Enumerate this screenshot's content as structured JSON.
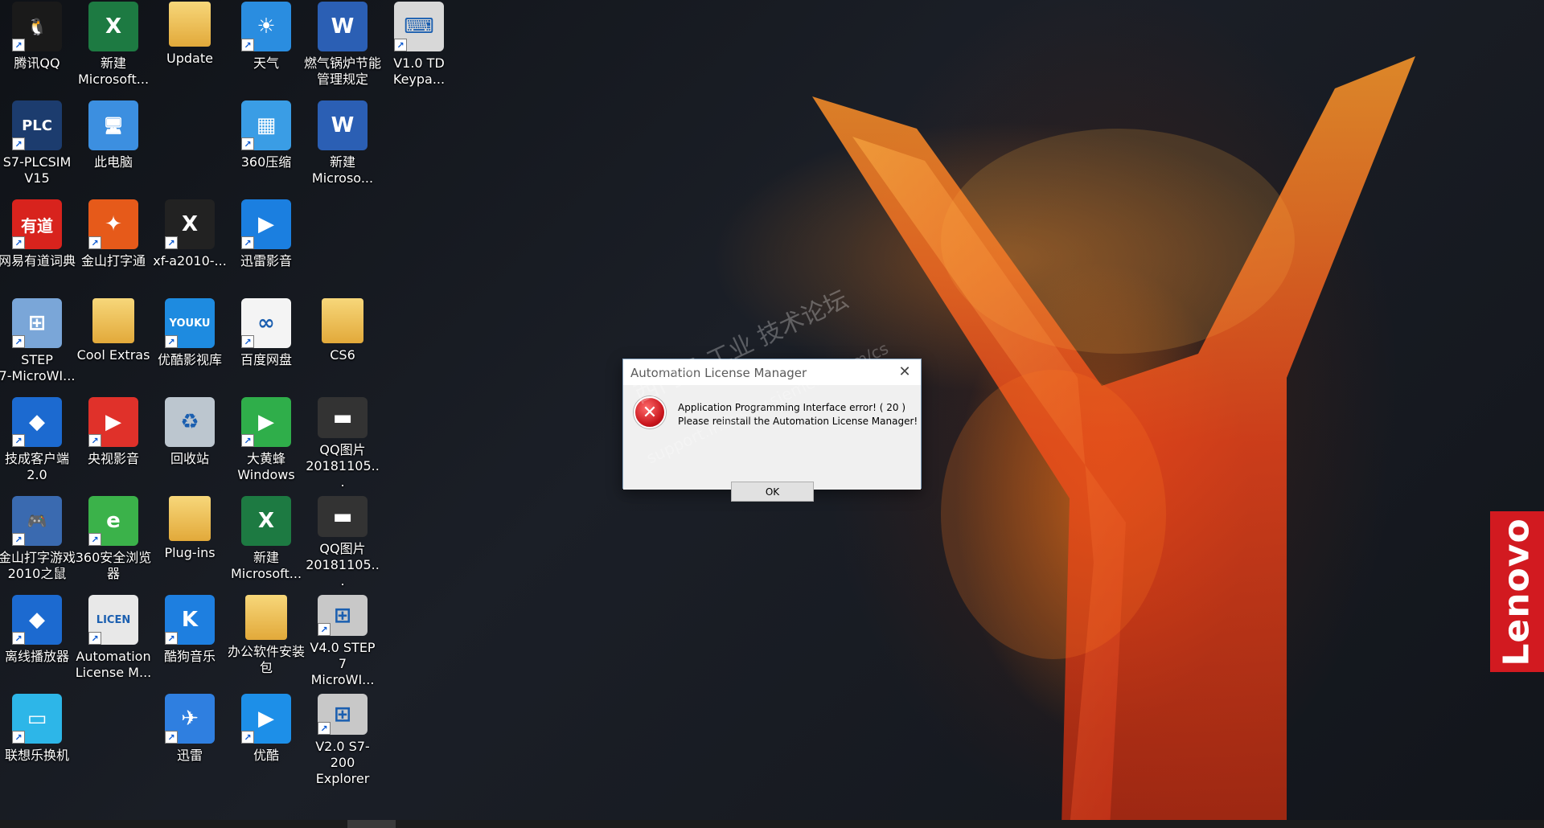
{
  "desktop": {
    "icons": [
      {
        "label": "腾讯QQ",
        "icon": "qq-penguin-icon",
        "color": "#1a1a1a",
        "glyph": "🐧"
      },
      {
        "label": "新建\nMicrosoft...",
        "icon": "excel-file-icon",
        "color": "#1d7a42",
        "glyph": "X"
      },
      {
        "label": "Update",
        "icon": "folder-icon",
        "color": "#e9b949",
        "glyph": ""
      },
      {
        "label": "天气",
        "icon": "weather-sun-icon",
        "color": "#2a8de0",
        "glyph": "☀"
      },
      {
        "label": "燃气锅炉节能\n管理规定",
        "icon": "word-document-icon",
        "color": "#2b5fb4",
        "glyph": "W"
      },
      {
        "label": "V1.0 TD\nKeypa...",
        "icon": "td-keypad-icon",
        "color": "#d8d8d8",
        "glyph": "⌨"
      },
      {
        "label": "S7-PLCSIM\nV15",
        "icon": "plcsim-icon",
        "color": "#1c3c6e",
        "glyph": "PLC"
      },
      {
        "label": "此电脑",
        "icon": "computer-icon",
        "color": "#3c8fe0",
        "glyph": "🖥"
      },
      {
        "label": "360压缩",
        "icon": "archive-360-icon",
        "color": "#3a9de5",
        "glyph": "▦"
      },
      {
        "label": "新建\nMicroso...",
        "icon": "word-document-icon",
        "color": "#2b5fb4",
        "glyph": "W"
      },
      {
        "label": "网易有道词典",
        "icon": "youdao-dictionary-icon",
        "color": "#d8231d",
        "glyph": "有道"
      },
      {
        "label": "金山打字通",
        "icon": "kingsoft-typing-icon",
        "color": "#e65a1a",
        "glyph": "✦"
      },
      {
        "label": "xf-a2010-...",
        "icon": "keygen-x-icon",
        "color": "#222222",
        "glyph": "X"
      },
      {
        "label": "迅雷影音",
        "icon": "xunlei-player-icon",
        "color": "#1b7fe0",
        "glyph": "▶"
      },
      {
        "label": "STEP\n7-MicroWI...",
        "icon": "step7-microwin-icon",
        "color": "#7aa6d8",
        "glyph": "⊞"
      },
      {
        "label": "Cool Extras",
        "icon": "folder-icon",
        "color": "#e9b949",
        "glyph": ""
      },
      {
        "label": "优酷影视库",
        "icon": "youku-cloud-icon",
        "color": "#1e8be0",
        "glyph": "YOUKU"
      },
      {
        "label": "百度网盘",
        "icon": "baidu-netdisk-icon",
        "color": "#f4f4f4",
        "glyph": "∞"
      },
      {
        "label": "CS6",
        "icon": "folder-icon",
        "color": "#e9b949",
        "glyph": ""
      },
      {
        "label": "技成客户端\n2.0",
        "icon": "jicheng-client-icon",
        "color": "#1c6ad0",
        "glyph": "◆"
      },
      {
        "label": "央视影音",
        "icon": "cctv-player-icon",
        "color": "#e0312a",
        "glyph": "▶"
      },
      {
        "label": "回收站",
        "icon": "recycle-bin-icon",
        "color": "#bcc6cf",
        "glyph": "♻"
      },
      {
        "label": "大黄蜂\nWindows",
        "icon": "video-editor-icon",
        "color": "#2fae4a",
        "glyph": "▶"
      },
      {
        "label": "QQ图片\n20181105...",
        "icon": "image-file-icon",
        "color": "#333333",
        "glyph": "▬"
      },
      {
        "label": "金山打字游戏\n2010之鼠",
        "icon": "typing-game-icon",
        "color": "#3a6ab0",
        "glyph": "🎮"
      },
      {
        "label": "360安全浏览\n器",
        "icon": "browser-360-icon",
        "color": "#3bb24a",
        "glyph": "e"
      },
      {
        "label": "Plug-ins",
        "icon": "folder-icon",
        "color": "#e9b949",
        "glyph": ""
      },
      {
        "label": "新建\nMicrosoft...",
        "icon": "excel-file-icon",
        "color": "#1d7a42",
        "glyph": "X"
      },
      {
        "label": "QQ图片\n20181105...",
        "icon": "image-file-icon",
        "color": "#333333",
        "glyph": "▬"
      },
      {
        "label": "离线播放器",
        "icon": "offline-player-icon",
        "color": "#1c6ad0",
        "glyph": "◆"
      },
      {
        "label": "Automation\nLicense M...",
        "icon": "license-manager-icon",
        "color": "#e8e8e8",
        "glyph": "LICEN"
      },
      {
        "label": "酷狗音乐",
        "icon": "kugou-music-icon",
        "color": "#1e7fe0",
        "glyph": "K"
      },
      {
        "label": "办公软件安装\n包",
        "icon": "folder-icon",
        "color": "#e9b949",
        "glyph": ""
      },
      {
        "label": "V4.0 STEP 7\nMicroWI...",
        "icon": "step7-microwin-icon",
        "color": "#c8c8c8",
        "glyph": "⊞"
      },
      {
        "label": "联想乐换机",
        "icon": "lenovo-phone-transfer-icon",
        "color": "#2db6e8",
        "glyph": "▭"
      },
      {
        "label": "迅雷",
        "icon": "xunlei-bird-icon",
        "color": "#2f7fe0",
        "glyph": "✈"
      },
      {
        "label": "优酷",
        "icon": "youku-player-icon",
        "color": "#1d8fe8",
        "glyph": "▶"
      },
      {
        "label": "V2.0 S7-200\nExplorer",
        "icon": "s7-200-explorer-icon",
        "color": "#c8c8c8",
        "glyph": "⊞"
      }
    ]
  },
  "dialog": {
    "title": "Automation License Manager",
    "close_glyph": "✕",
    "error_glyph": "✕",
    "message_line1": "Application Programming Interface error! ( 20 )",
    "message_line2": "Please reinstall the Automation License Manager!",
    "ok_label": "OK"
  },
  "watermark": {
    "line1": "西门子 工业 技术论坛",
    "line2": "support.industry.siemens.com/cs"
  },
  "brand": {
    "lenovo_label": "Lenovo",
    "lenovo_color": "#d21a20"
  }
}
